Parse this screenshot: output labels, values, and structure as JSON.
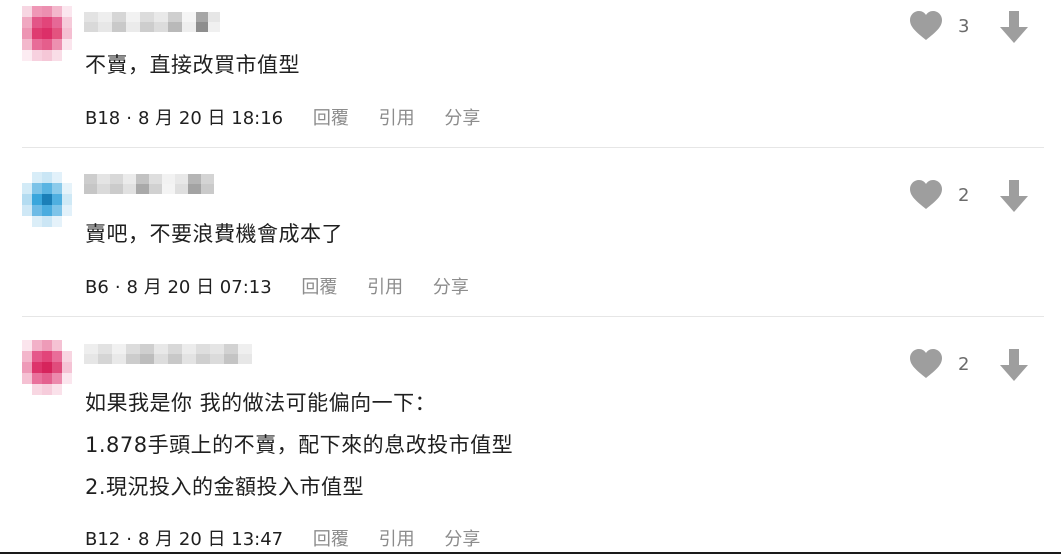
{
  "comments": [
    {
      "floor": "B18",
      "date": "8 月 20 日 18:16",
      "likes": "3",
      "lines": [
        "不賣，直接改買市值型"
      ]
    },
    {
      "floor": "B6",
      "date": "8 月 20 日 07:13",
      "likes": "2",
      "lines": [
        "賣吧，不要浪費機會成本了"
      ]
    },
    {
      "floor": "B12",
      "date": "8 月 20 日 13:47",
      "likes": "2",
      "lines": [
        "如果我是你 我的做法可能偏向一下：",
        "1.878手頭上的不賣，配下來的息改投市值型",
        "2.現況投入的金額投入市值型"
      ]
    }
  ],
  "actions": {
    "reply": "回覆",
    "quote": "引用",
    "share": "分享"
  },
  "separator": "·",
  "icons": {
    "like": "heart-icon",
    "vote_down": "arrow-down-icon"
  },
  "colors": {
    "icon_gray": "#9e9e9e",
    "action_gray": "#8c8c8c",
    "avatar_pink": "#e2457a",
    "avatar_blue": "#3aa6dc",
    "divider": "#e6e6e6"
  }
}
